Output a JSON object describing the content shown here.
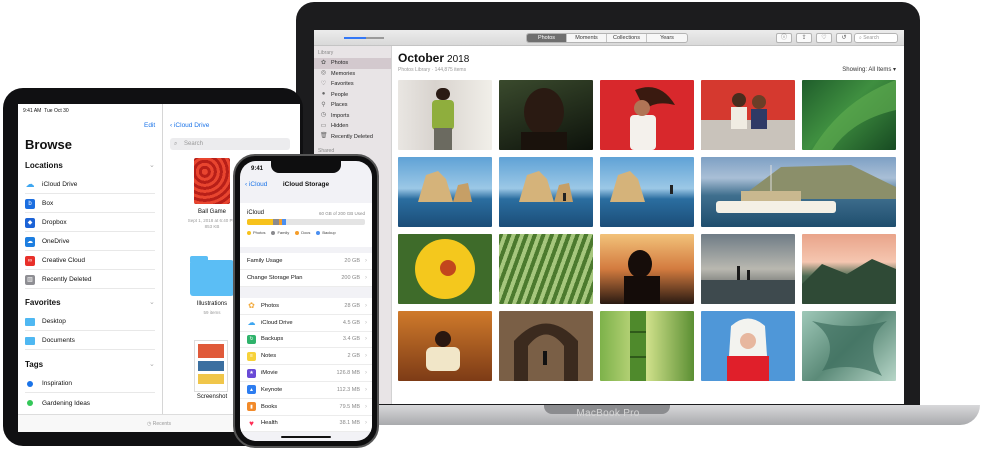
{
  "macbook": {
    "device_label": "MacBook Pro",
    "toolbar": {
      "tabs": [
        {
          "label": "Photos",
          "active": true
        },
        {
          "label": "Moments",
          "active": false
        },
        {
          "label": "Collections",
          "active": false
        },
        {
          "label": "Years",
          "active": false
        }
      ],
      "buttons": [
        "info-icon",
        "share-icon",
        "heart-icon",
        "rotate-icon"
      ],
      "search_placeholder": "Search"
    },
    "sidebar": {
      "section_library": "Library",
      "items": [
        {
          "label": "Photos",
          "icon": "photos-icon",
          "active": true
        },
        {
          "label": "Memories",
          "icon": "memories-icon",
          "active": false
        },
        {
          "label": "Favorites",
          "icon": "heart-icon",
          "active": false
        },
        {
          "label": "People",
          "icon": "person-icon",
          "active": false
        },
        {
          "label": "Places",
          "icon": "pin-icon",
          "active": false
        },
        {
          "label": "Imports",
          "icon": "clock-icon",
          "active": false
        },
        {
          "label": "Hidden",
          "icon": "hidden-icon",
          "active": false
        },
        {
          "label": "Recently Deleted",
          "icon": "trash-icon",
          "active": false
        }
      ],
      "section_shared": "Shared"
    },
    "main": {
      "month": "October",
      "year": "2018",
      "library_info": "Photos Library · 144,875 items",
      "showing": "Showing: All Items ▾"
    }
  },
  "ipad": {
    "status_time": "9:41 AM",
    "status_date": "Tue Oct 30",
    "edit_label": "Edit",
    "title": "Browse",
    "locations_header": "Locations",
    "locations": [
      {
        "label": "iCloud Drive",
        "color": "#3ea6f0",
        "icon": "cloud-icon"
      },
      {
        "label": "Box",
        "color": "#1b6ee0",
        "icon": "box-icon"
      },
      {
        "label": "Dropbox",
        "color": "#1c63d6",
        "icon": "dropbox-icon"
      },
      {
        "label": "OneDrive",
        "color": "#1d7ee0",
        "icon": "onedrive-icon"
      },
      {
        "label": "Creative Cloud",
        "color": "#e8302a",
        "icon": "creative-cloud-icon"
      },
      {
        "label": "Recently Deleted",
        "color": "#8e8e93",
        "icon": "trash-icon"
      }
    ],
    "favorites_header": "Favorites",
    "favorites": [
      {
        "label": "Desktop",
        "icon": "folder-icon"
      },
      {
        "label": "Documents",
        "icon": "folder-icon"
      }
    ],
    "tags_header": "Tags",
    "tags": [
      {
        "label": "Inspiration",
        "color": "#1a73e8"
      },
      {
        "label": "Gardening Ideas",
        "color": "#34c759"
      }
    ],
    "right": {
      "back_label": "iCloud Drive",
      "search_placeholder": "Search",
      "files": [
        {
          "name": "Ball Game",
          "date": "Sept 1, 2018 at 6:40 PM",
          "size": "853 KB"
        },
        {
          "name": "Illustrations",
          "date": "59 items",
          "size": ""
        },
        {
          "name": "Screenshot",
          "date": "",
          "size": ""
        }
      ]
    },
    "tab_recents": "Recents"
  },
  "iphone": {
    "time": "9:41",
    "back_label": "iCloud",
    "title": "iCloud Storage",
    "icloud_label": "iCloud",
    "icloud_used": "60 GB of 200 GB Used",
    "legend": [
      {
        "label": "Photos",
        "color": "#f7c21c"
      },
      {
        "label": "Family",
        "color": "#8a8a8e"
      },
      {
        "label": "Docs",
        "color": "#f59d2a"
      },
      {
        "label": "Backup",
        "color": "#4a8ff0"
      }
    ],
    "plan_rows": [
      {
        "label": "Family Usage",
        "value": "20 GB"
      },
      {
        "label": "Change Storage Plan",
        "value": "200 GB"
      }
    ],
    "apps": [
      {
        "label": "Photos",
        "value": "28 GB",
        "color": "#f2a93b",
        "icon": "photos-icon"
      },
      {
        "label": "iCloud Drive",
        "value": "4.5 GB",
        "color": "#3ea6f0",
        "icon": "cloud-icon"
      },
      {
        "label": "Backups",
        "value": "3.4 GB",
        "color": "#2fb36b",
        "icon": "backup-icon"
      },
      {
        "label": "Notes",
        "value": "2 GB",
        "color": "#f7d23a",
        "icon": "notes-icon"
      },
      {
        "label": "iMovie",
        "value": "126.8 MB",
        "color": "#6a4bd6",
        "icon": "star-icon"
      },
      {
        "label": "Keynote",
        "value": "112.3 MB",
        "color": "#2d7df0",
        "icon": "keynote-icon"
      },
      {
        "label": "Books",
        "value": "79.5 MB",
        "color": "#f28a2a",
        "icon": "book-icon"
      },
      {
        "label": "Health",
        "value": "38.1 MB",
        "color": "#ffffff",
        "icon": "heart-icon"
      }
    ]
  }
}
